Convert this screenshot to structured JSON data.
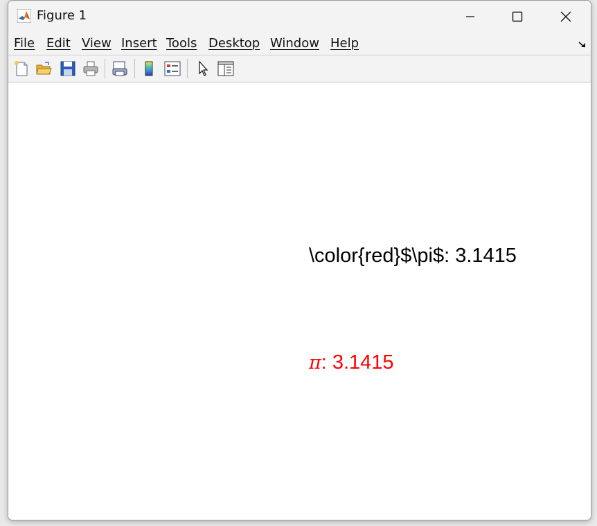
{
  "window": {
    "title": "Figure 1",
    "app_icon": "matlab-logo-icon",
    "controls": [
      "minimize-icon",
      "maximize-icon",
      "close-icon"
    ]
  },
  "menu": {
    "items": [
      {
        "label": "File"
      },
      {
        "label": "Edit"
      },
      {
        "label": "View"
      },
      {
        "label": "Insert"
      },
      {
        "label": "Tools"
      },
      {
        "label": "Desktop"
      },
      {
        "label": "Window"
      },
      {
        "label": "Help"
      }
    ],
    "dock_arrow_icon": "undock-arrow-icon"
  },
  "toolbar": {
    "buttons": [
      "new-figure-icon",
      "open-file-icon",
      "save-icon",
      "print-icon",
      "link-plot-icon",
      "colorbar-icon",
      "legend-icon",
      "edit-plot-arrow-icon",
      "property-inspector-icon"
    ]
  },
  "figure": {
    "text_raw": "\\color{red}$\\pi$: 3.1415",
    "text_rendered_symbol": "π",
    "text_rendered_value": ": 3.1415",
    "rendered_color": "#ff0000",
    "raw_color": "#000000"
  }
}
